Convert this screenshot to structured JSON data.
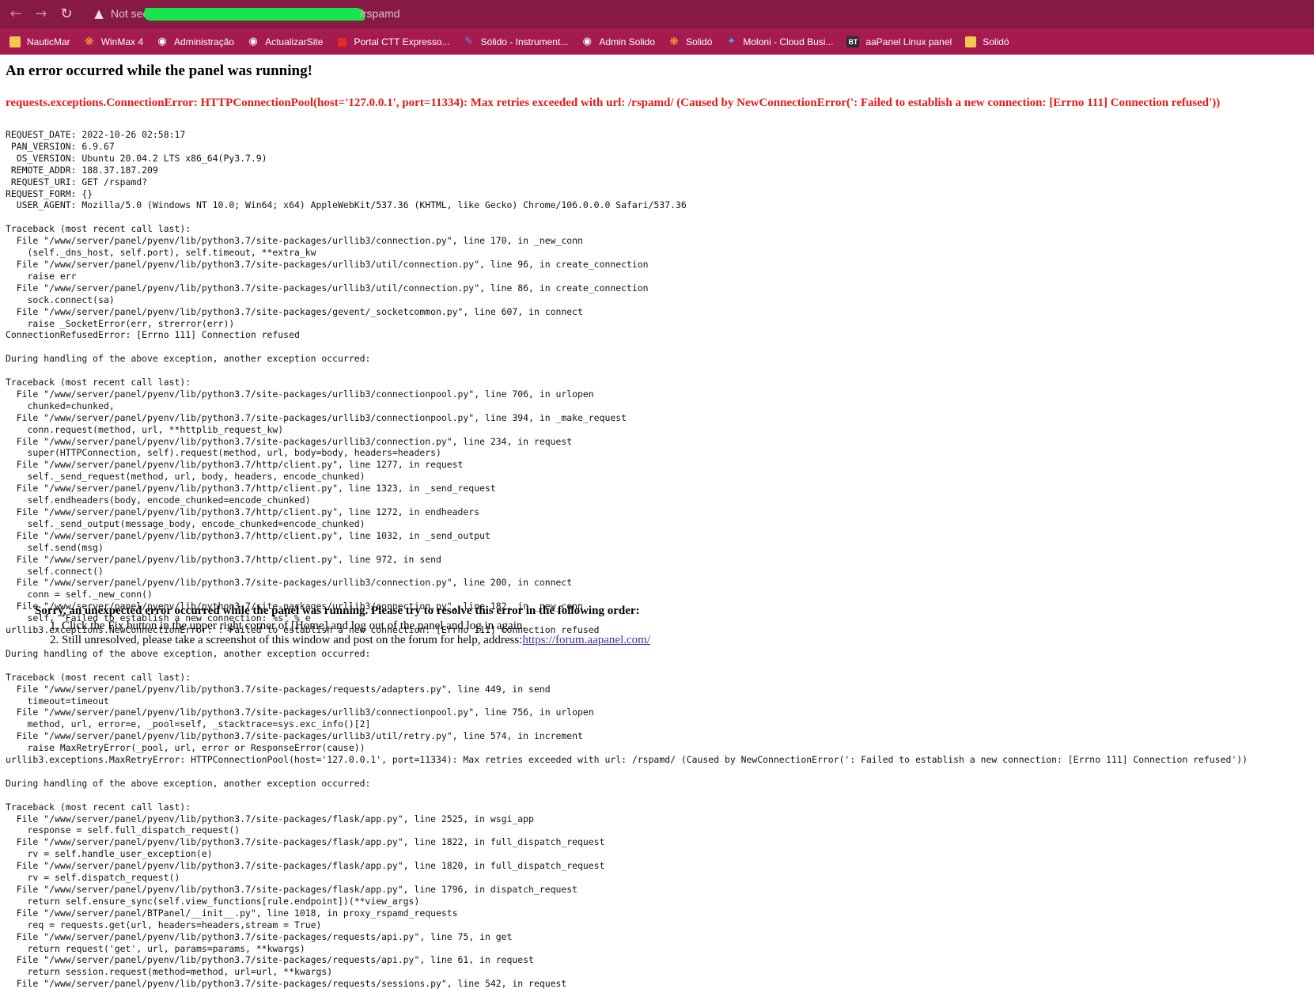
{
  "browser": {
    "nav": {
      "back_icon": "arrow-left-icon",
      "forward_icon": "arrow-right-icon",
      "reload_icon": "reload-icon"
    },
    "address": {
      "security_label": "Not secure",
      "security_prefix_visible": "Not secu",
      "path_suffix": "/rspamd",
      "redaction_color": "#16e64b"
    },
    "bookmarks": [
      {
        "label": "NauticMar",
        "icon": "folder-icon"
      },
      {
        "label": "WinMax 4",
        "icon": "gear-icon"
      },
      {
        "label": "Administração",
        "icon": "globe-icon"
      },
      {
        "label": "ActualizarSite",
        "icon": "globe-icon"
      },
      {
        "label": "Portal CTT Expresso...",
        "icon": "ctt-icon"
      },
      {
        "label": "Sólido - Instrument...",
        "icon": "tool-icon"
      },
      {
        "label": "Admin Solido",
        "icon": "globe-icon"
      },
      {
        "label": "Solidó",
        "icon": "gear-icon"
      },
      {
        "label": "Moloni - Cloud Busi...",
        "icon": "moloni-icon"
      },
      {
        "label": "aaPanel Linux panel",
        "icon": "bt-icon",
        "icon_text": "BT"
      },
      {
        "label": "Solidó",
        "icon": "folder-icon"
      }
    ],
    "colors": {
      "address_bar": "#861a44",
      "bookmarks_bar": "#a51b50"
    }
  },
  "page": {
    "title": "An error occurred while the panel was running!",
    "error": "requests.exceptions.ConnectionError: HTTPConnectionPool(host='127.0.0.1', port=11334): Max retries exceeded with url: /rspamd/ (Caused by NewConnectionError(': Failed to establish a new connection: [Errno 111] Connection refused'))",
    "error_color": "#e51919",
    "traceback": "REQUEST_DATE: 2022-10-26 02:58:17\n PAN_VERSION: 6.9.67\n  OS_VERSION: Ubuntu 20.04.2 LTS x86_64(Py3.7.9)\n REMOTE_ADDR: 188.37.187.209\n REQUEST_URI: GET /rspamd?\nREQUEST_FORM: {}\n  USER_AGENT: Mozilla/5.0 (Windows NT 10.0; Win64; x64) AppleWebKit/537.36 (KHTML, like Gecko) Chrome/106.0.0.0 Safari/537.36\n\nTraceback (most recent call last):\n  File \"/www/server/panel/pyenv/lib/python3.7/site-packages/urllib3/connection.py\", line 170, in _new_conn\n    (self._dns_host, self.port), self.timeout, **extra_kw\n  File \"/www/server/panel/pyenv/lib/python3.7/site-packages/urllib3/util/connection.py\", line 96, in create_connection\n    raise err\n  File \"/www/server/panel/pyenv/lib/python3.7/site-packages/urllib3/util/connection.py\", line 86, in create_connection\n    sock.connect(sa)\n  File \"/www/server/panel/pyenv/lib/python3.7/site-packages/gevent/_socketcommon.py\", line 607, in connect\n    raise _SocketError(err, strerror(err))\nConnectionRefusedError: [Errno 111] Connection refused\n\nDuring handling of the above exception, another exception occurred:\n\nTraceback (most recent call last):\n  File \"/www/server/panel/pyenv/lib/python3.7/site-packages/urllib3/connectionpool.py\", line 706, in urlopen\n    chunked=chunked,\n  File \"/www/server/panel/pyenv/lib/python3.7/site-packages/urllib3/connectionpool.py\", line 394, in _make_request\n    conn.request(method, url, **httplib_request_kw)\n  File \"/www/server/panel/pyenv/lib/python3.7/site-packages/urllib3/connection.py\", line 234, in request\n    super(HTTPConnection, self).request(method, url, body=body, headers=headers)\n  File \"/www/server/panel/pyenv/lib/python3.7/http/client.py\", line 1277, in request\n    self._send_request(method, url, body, headers, encode_chunked)\n  File \"/www/server/panel/pyenv/lib/python3.7/http/client.py\", line 1323, in _send_request\n    self.endheaders(body, encode_chunked=encode_chunked)\n  File \"/www/server/panel/pyenv/lib/python3.7/http/client.py\", line 1272, in endheaders\n    self._send_output(message_body, encode_chunked=encode_chunked)\n  File \"/www/server/panel/pyenv/lib/python3.7/http/client.py\", line 1032, in _send_output\n    self.send(msg)\n  File \"/www/server/panel/pyenv/lib/python3.7/http/client.py\", line 972, in send\n    self.connect()\n  File \"/www/server/panel/pyenv/lib/python3.7/site-packages/urllib3/connection.py\", line 200, in connect\n    conn = self._new_conn()\n  File \"/www/server/panel/pyenv/lib/python3.7/site-packages/urllib3/connection.py\", line 182, in _new_conn\n    self, \"Failed to establish a new connection: %s\" % e\nurllib3.exceptions.NewConnectionError: : Failed to establish a new connection: [Errno 111] Connection refused\n\nDuring handling of the above exception, another exception occurred:\n\nTraceback (most recent call last):\n  File \"/www/server/panel/pyenv/lib/python3.7/site-packages/requests/adapters.py\", line 449, in send\n    timeout=timeout\n  File \"/www/server/panel/pyenv/lib/python3.7/site-packages/urllib3/connectionpool.py\", line 756, in urlopen\n    method, url, error=e, _pool=self, _stacktrace=sys.exc_info()[2]\n  File \"/www/server/panel/pyenv/lib/python3.7/site-packages/urllib3/util/retry.py\", line 574, in increment\n    raise MaxRetryError(_pool, url, error or ResponseError(cause))\nurllib3.exceptions.MaxRetryError: HTTPConnectionPool(host='127.0.0.1', port=11334): Max retries exceeded with url: /rspamd/ (Caused by NewConnectionError(': Failed to establish a new connection: [Errno 111] Connection refused'))\n\nDuring handling of the above exception, another exception occurred:\n\nTraceback (most recent call last):\n  File \"/www/server/panel/pyenv/lib/python3.7/site-packages/flask/app.py\", line 2525, in wsgi_app\n    response = self.full_dispatch_request()\n  File \"/www/server/panel/pyenv/lib/python3.7/site-packages/flask/app.py\", line 1822, in full_dispatch_request\n    rv = self.handle_user_exception(e)\n  File \"/www/server/panel/pyenv/lib/python3.7/site-packages/flask/app.py\", line 1820, in full_dispatch_request\n    rv = self.dispatch_request()\n  File \"/www/server/panel/pyenv/lib/python3.7/site-packages/flask/app.py\", line 1796, in dispatch_request\n    return self.ensure_sync(self.view_functions[rule.endpoint])(**view_args)\n  File \"/www/server/panel/BTPanel/__init__.py\", line 1018, in proxy_rspamd_requests\n    req = requests.get(url, headers=headers,stream = True)\n  File \"/www/server/panel/pyenv/lib/python3.7/site-packages/requests/api.py\", line 75, in get\n    return request('get', url, params=params, **kwargs)\n  File \"/www/server/panel/pyenv/lib/python3.7/site-packages/requests/api.py\", line 61, in request\n    return session.request(method=method, url=url, **kwargs)\n  File \"/www/server/panel/pyenv/lib/python3.7/site-packages/requests/sessions.py\", line 542, in request",
    "notice": {
      "title": "Sorry, an unexpected error occurred while the panel was running. Please try to resolve this error in the following order:",
      "step1": "1. Click the Fix button in the upper right corner of [Home] and log out of the panel and log in again.",
      "step2_prefix": "2. Still unresolved, please take a screenshot of this window and post on the forum for help, address:",
      "forum_url": "https://forum.aapanel.com/"
    }
  }
}
